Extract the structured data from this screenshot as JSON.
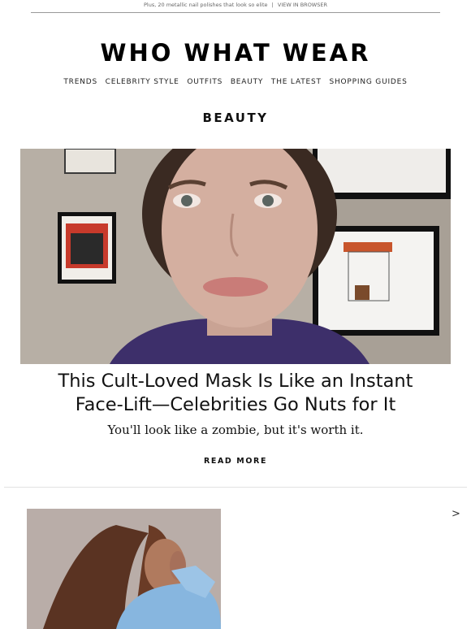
{
  "preheader": {
    "text": "Plus, 20 metallic nail polishes that look so elite",
    "separator": "|",
    "link": "VIEW IN BROWSER"
  },
  "brand": {
    "logo": "WHO WHAT WEAR"
  },
  "nav": {
    "items": [
      "TRENDS",
      "CELEBRITY STYLE",
      "OUTFITS",
      "BEAUTY",
      "THE LATEST",
      "SHOPPING GUIDES"
    ]
  },
  "section": {
    "title": "BEAUTY"
  },
  "hero_story": {
    "image_icon": "hero-photo",
    "headline_line1": "This Cult-Loved Mask Is Like an Instant",
    "headline_line2": "Face-Lift—Celebrities Go Nuts for It",
    "dek": "You'll look like a zombie, but it's worth it.",
    "cta": "READ MORE"
  },
  "next_story": {
    "image_icon": "thumbnail-photo",
    "arrow": ">"
  },
  "colors": {
    "text": "#111111",
    "muted": "#666666",
    "rule": "#999999"
  }
}
